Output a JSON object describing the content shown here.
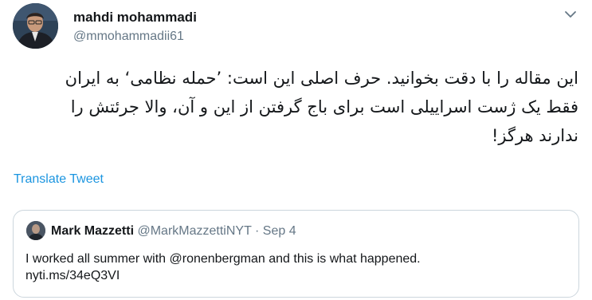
{
  "author": {
    "name": "mahdi mohammadi",
    "handle": "@mmohammadii61"
  },
  "menu_icon": "chevron-down-icon",
  "tweet": {
    "lines": [
      "این مقاله را با دقت بخوانید. حرف اصلی این است: ’حمله نظامی‘ به ایران",
      "فقط یک ژست اسراییلی است برای باج گرفتن از این و آن، والا جرئتش را",
      "ندارند هرگز!"
    ]
  },
  "translate_label": "Translate Tweet",
  "quoted": {
    "name": "Mark Mazzetti",
    "handle": "@MarkMazzettiNYT",
    "separator": "·",
    "date": "Sep 4",
    "lines": [
      "I worked all summer with @ronenbergman and this is what happened.",
      "nyti.ms/34eQ3VI"
    ]
  },
  "colors": {
    "link": "#1b95e0",
    "secondary_text": "#657786",
    "border": "#ccd6dd"
  }
}
